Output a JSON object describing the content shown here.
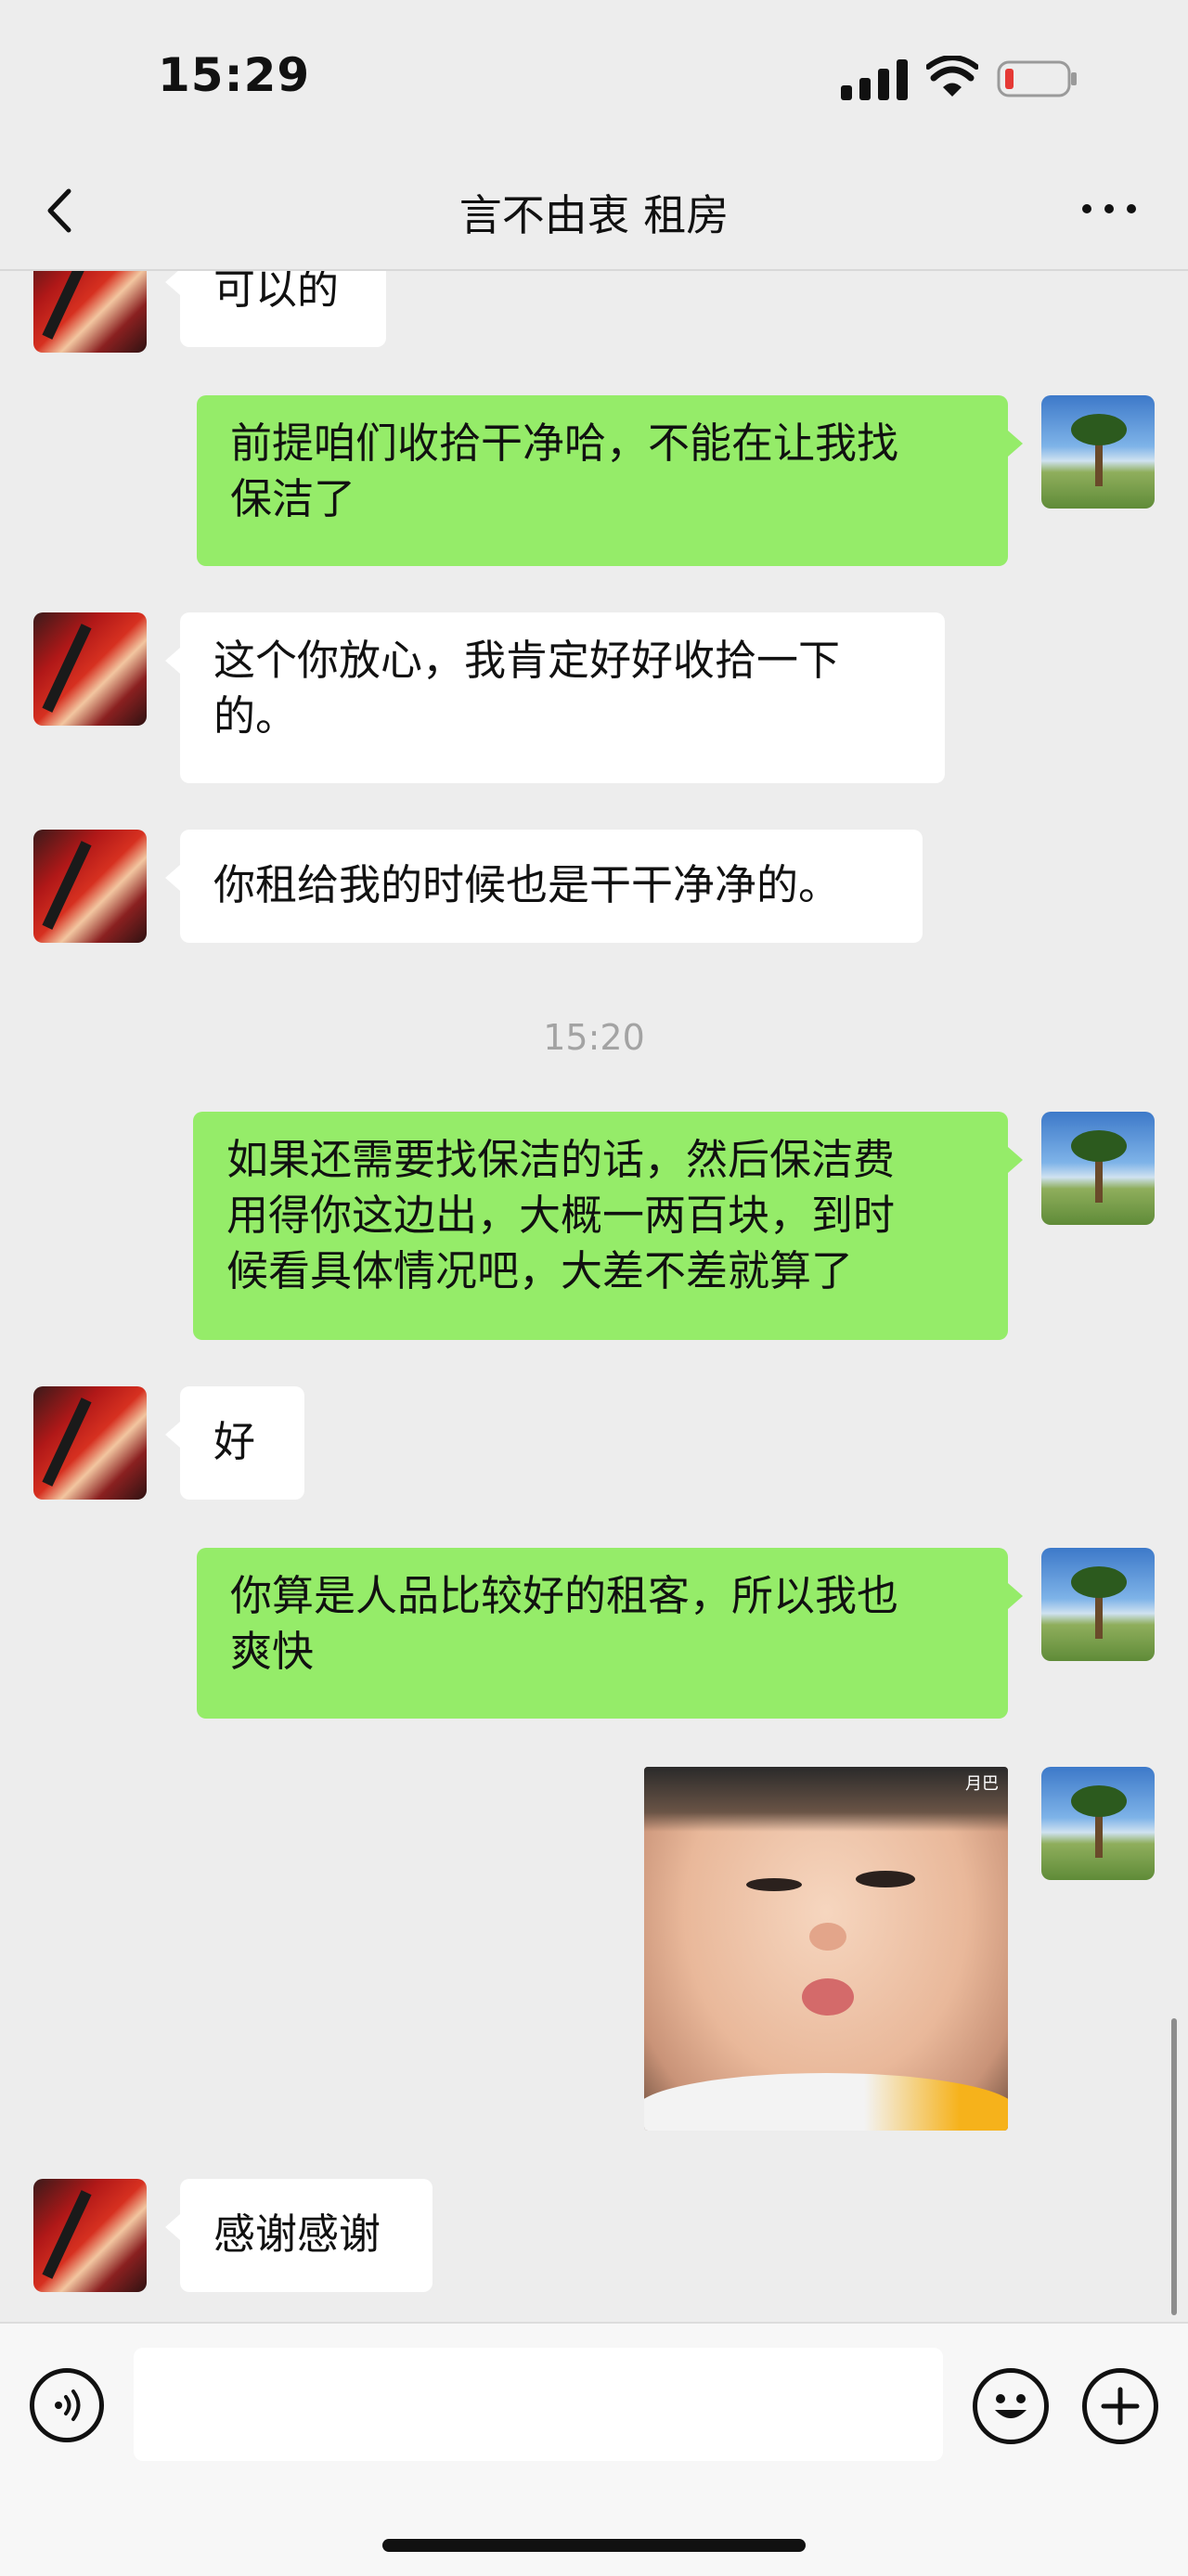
{
  "status_bar": {
    "time": "15:29"
  },
  "nav": {
    "title": "言不由衷 租房"
  },
  "messages": [
    {
      "text": "可以的"
    },
    {
      "text": "前提咱们收拾干净哈，不能在让我找\n保洁了"
    },
    {
      "text": "这个你放心，我肯定好好收拾一下\n的。"
    },
    {
      "text": "你租给我的时候也是干干净净的。"
    },
    {
      "text": "15:20"
    },
    {
      "text": "如果还需要找保洁的话，然后保洁费\n用得你这边出，大概一两百块，到时\n候看具体情况吧，大差不差就算了"
    },
    {
      "text": "好"
    },
    {
      "text": "你算是人品比较好的租客，所以我也\n爽快"
    },
    {
      "text": "月巴"
    },
    {
      "text": "感谢感谢"
    }
  ],
  "input": {
    "value": ""
  },
  "colors": {
    "background": "#ededed",
    "outgoing_bubble": "#95ec69",
    "incoming_bubble": "#ffffff",
    "battery_low": "#e53935"
  }
}
